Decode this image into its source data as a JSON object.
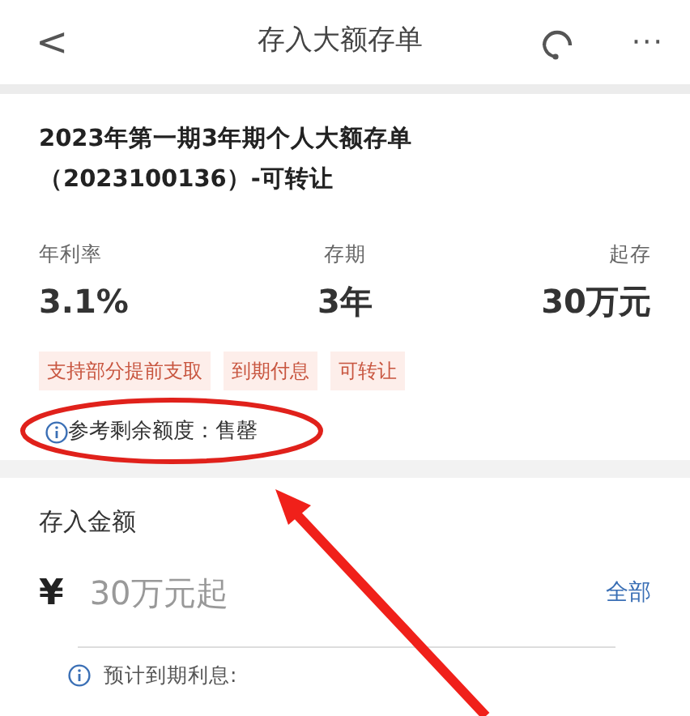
{
  "header": {
    "back": "<",
    "title": "存入大额存单",
    "more": "···"
  },
  "product": {
    "title": "2023年第一期3年期个人大额存单",
    "code": "（2023100136）-可转让"
  },
  "stats": [
    {
      "label": "年利率",
      "value": "3.1%"
    },
    {
      "label": "存期",
      "value": "3年"
    },
    {
      "label": "起存",
      "value": "30万元"
    }
  ],
  "tags": [
    "支持部分提前支取",
    "到期付息",
    "可转让"
  ],
  "quota": "参考剩余额度：售罄",
  "amount": {
    "label": "存入金额",
    "currency": "¥",
    "placeholder": "30万元起",
    "all_link": "全部"
  },
  "interest_note": "预计到期利息:"
}
